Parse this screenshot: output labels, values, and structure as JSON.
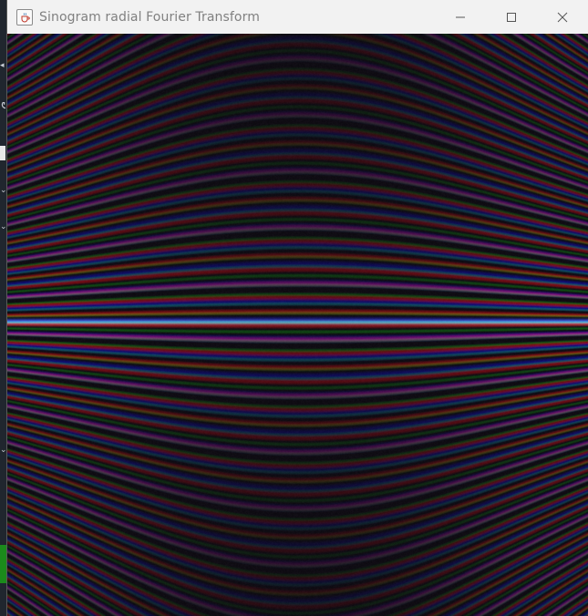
{
  "window": {
    "title": "Sinogram radial Fourier Transform",
    "icon": "java-cup-icon",
    "controls": {
      "minimize": "minimize-icon",
      "maximize": "maximize-icon",
      "close": "close-icon"
    }
  },
  "image": {
    "description_kind": "radial Fourier transform of sinogram rendered as colored interference pattern",
    "colors": {
      "background": "#0f0d12",
      "red": "#8a1020",
      "green": "#1e6a2c",
      "blue": "#1c1f7a",
      "teal": "#2a8f88"
    }
  }
}
